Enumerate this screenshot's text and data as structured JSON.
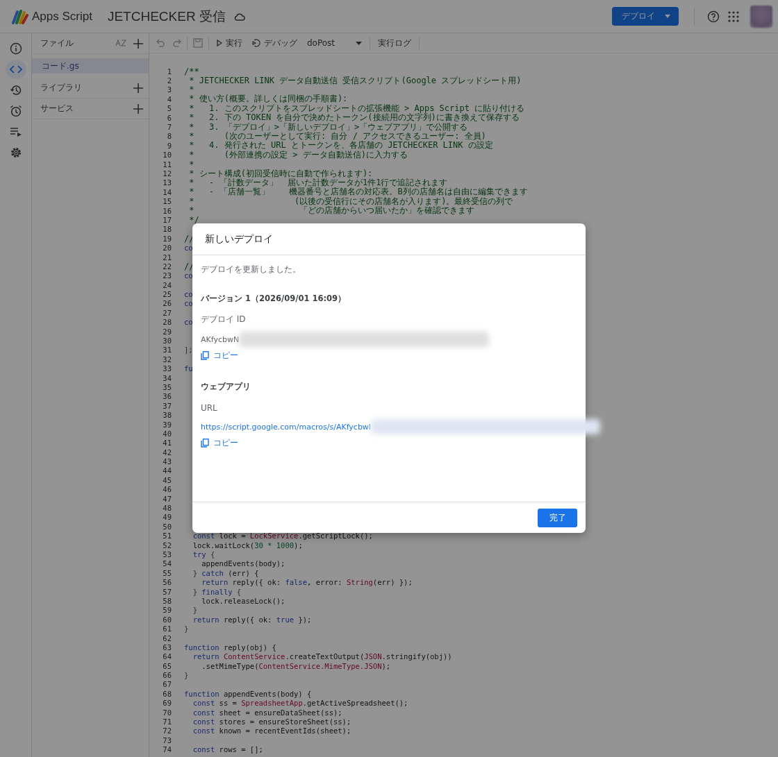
{
  "app": {
    "name": "Apps Script",
    "project_title": "JETCHECKER 受信",
    "deploy_button": "デプロイ"
  },
  "rail": [
    {
      "kind": "info",
      "selected": false
    },
    {
      "kind": "code",
      "selected": true
    },
    {
      "kind": "history",
      "selected": false
    },
    {
      "kind": "triggers",
      "selected": false
    },
    {
      "kind": "executions",
      "selected": false
    },
    {
      "kind": "settings",
      "selected": false
    }
  ],
  "files_panel": {
    "title": "ファイル",
    "files": [
      {
        "name": "コード.gs",
        "selected": true
      }
    ],
    "sections": [
      "ライブラリ",
      "サービス"
    ]
  },
  "toolbar": {
    "run": "実行",
    "debug": "デバッグ",
    "function": "doPost",
    "log": "実行ログ"
  },
  "editor": {
    "lines": [
      {
        "number": "1",
        "kind": "comment",
        "text": "/**"
      },
      {
        "number": "2",
        "kind": "comment",
        "text": " * JETCHECKER LINK データ自動送信 受信スクリプト(Google スプレッドシート用)"
      },
      {
        "number": "3",
        "kind": "comment",
        "text": " *"
      },
      {
        "number": "4",
        "kind": "comment",
        "text": " * 使い方(概要。詳しくは同梱の手順書):"
      },
      {
        "number": "5",
        "kind": "comment",
        "text": " *   1. このスクリプトをスプレッドシートの拡張機能 > Apps Script に貼り付ける"
      },
      {
        "number": "6",
        "kind": "comment",
        "text": " *   2. 下の TOKEN を自分で決めたトークン(接続用の文字列)に書き換えて保存する"
      },
      {
        "number": "7",
        "kind": "comment",
        "text": " *   3. 「デプロイ」>「新しいデプロイ」>「ウェブアプリ」で公開する"
      },
      {
        "number": "8",
        "kind": "comment",
        "text": " *      (次のユーザーとして実行: 自分 / アクセスできるユーザー: 全員)"
      },
      {
        "number": "9",
        "kind": "comment",
        "text": " *   4. 発行された URL とトークンを、各店舗の JETCHECKER LINK の設定"
      },
      {
        "number": "10",
        "kind": "comment",
        "text": " *      (外部連携の設定 > データ自動送信)に入力する"
      },
      {
        "number": "11",
        "kind": "comment",
        "text": " *"
      },
      {
        "number": "12",
        "kind": "comment",
        "text": " * シート構成(初回受信時に自動で作られます):"
      },
      {
        "number": "13",
        "kind": "comment",
        "text": " *   - 「計数データ」  届いた計数データが1件1行で追記されます"
      },
      {
        "number": "14",
        "kind": "comment",
        "text": " *   - 「店舗一覧」    機器番号と店舗名の対応表。B列の店舗名は自由に編集できます"
      },
      {
        "number": "15",
        "kind": "comment",
        "text": " *                    (以後の受信行にその店舗名が入ります)。最終受信の列で"
      },
      {
        "number": "16",
        "kind": "comment",
        "text": " *                     「どの店舗からいつ届いたか」を確認できます"
      },
      {
        "number": "17",
        "kind": "comment",
        "text": " */"
      },
      {
        "number": "18",
        "kind": "blank"
      },
      {
        "number": "19",
        "kind": "comment",
        "text": "//"
      },
      {
        "number": "20",
        "kind": "code",
        "tokens": [
          {
            "text": "co",
            "kind": "keyword"
          }
        ]
      },
      {
        "number": "21",
        "kind": "blank"
      },
      {
        "number": "22",
        "kind": "comment",
        "text": "//"
      },
      {
        "number": "23",
        "kind": "code",
        "tokens": [
          {
            "text": "co",
            "kind": "keyword"
          }
        ]
      },
      {
        "number": "24",
        "kind": "blank"
      },
      {
        "number": "25",
        "kind": "code",
        "tokens": [
          {
            "text": "co",
            "kind": "keyword"
          }
        ]
      },
      {
        "number": "26",
        "kind": "code",
        "tokens": [
          {
            "text": "co",
            "kind": "keyword"
          }
        ]
      },
      {
        "number": "27",
        "kind": "blank"
      },
      {
        "number": "28",
        "kind": "code",
        "tokens": [
          {
            "text": "co",
            "kind": "keyword"
          }
        ]
      },
      {
        "number": "29",
        "kind": "blank"
      },
      {
        "number": "30",
        "kind": "blank"
      },
      {
        "number": "31",
        "kind": "code",
        "tokens": [
          {
            "text": "];",
            "kind": "punct"
          }
        ]
      },
      {
        "number": "32",
        "kind": "blank"
      },
      {
        "number": "33",
        "kind": "code",
        "tokens": [
          {
            "text": "fu",
            "kind": "keyword"
          }
        ]
      },
      {
        "number": "34",
        "kind": "blank"
      },
      {
        "number": "35",
        "kind": "blank"
      },
      {
        "number": "36",
        "kind": "blank"
      },
      {
        "number": "37",
        "kind": "blank"
      },
      {
        "number": "38",
        "kind": "blank"
      },
      {
        "number": "39",
        "kind": "blank"
      },
      {
        "number": "40",
        "kind": "blank"
      },
      {
        "number": "41",
        "kind": "blank"
      },
      {
        "number": "42",
        "kind": "blank"
      },
      {
        "number": "43",
        "kind": "blank"
      },
      {
        "number": "44",
        "kind": "blank"
      },
      {
        "number": "45",
        "kind": "blank"
      },
      {
        "number": "46",
        "kind": "blank"
      },
      {
        "number": "47",
        "kind": "blank"
      },
      {
        "number": "48",
        "kind": "blank"
      },
      {
        "number": "49",
        "kind": "blank"
      },
      {
        "number": "50",
        "kind": "blank"
      },
      {
        "number": "51",
        "kind": "code",
        "tokens": [
          {
            "text": "  const",
            "kind": "keyword"
          },
          {
            "text": " lock = ",
            "kind": "plain"
          },
          {
            "text": "LockService",
            "kind": "class"
          },
          {
            "text": ".getScriptLock();",
            "kind": "plain"
          }
        ]
      },
      {
        "number": "52",
        "kind": "code",
        "tokens": [
          {
            "text": "  lock.waitLock(",
            "kind": "plain"
          },
          {
            "text": "30 * 1000",
            "kind": "number"
          },
          {
            "text": ");",
            "kind": "plain"
          }
        ]
      },
      {
        "number": "53",
        "kind": "code",
        "tokens": [
          {
            "text": "  try",
            "kind": "keyword"
          },
          {
            "text": " {",
            "kind": "punct"
          }
        ]
      },
      {
        "number": "54",
        "kind": "code",
        "tokens": [
          {
            "text": "    appendEvents(body);",
            "kind": "plain"
          }
        ]
      },
      {
        "number": "55",
        "kind": "code",
        "tokens": [
          {
            "text": "  }",
            "kind": "punct"
          },
          {
            "text": " catch",
            "kind": "keyword"
          },
          {
            "text": " (err) {",
            "kind": "plain"
          }
        ]
      },
      {
        "number": "56",
        "kind": "code",
        "tokens": [
          {
            "text": "    return",
            "kind": "keyword"
          },
          {
            "text": " reply({ ok: ",
            "kind": "plain"
          },
          {
            "text": "false",
            "kind": "keyword"
          },
          {
            "text": ", error: ",
            "kind": "plain"
          },
          {
            "text": "String",
            "kind": "class"
          },
          {
            "text": "(err) });",
            "kind": "plain"
          }
        ]
      },
      {
        "number": "57",
        "kind": "code",
        "tokens": [
          {
            "text": "  }",
            "kind": "punct"
          },
          {
            "text": " finally",
            "kind": "keyword"
          },
          {
            "text": " {",
            "kind": "punct"
          }
        ]
      },
      {
        "number": "58",
        "kind": "code",
        "tokens": [
          {
            "text": "    lock.releaseLock();",
            "kind": "plain"
          }
        ]
      },
      {
        "number": "59",
        "kind": "code",
        "tokens": [
          {
            "text": "  }",
            "kind": "punct"
          }
        ]
      },
      {
        "number": "60",
        "kind": "code",
        "tokens": [
          {
            "text": "  return",
            "kind": "keyword"
          },
          {
            "text": " reply({ ok: ",
            "kind": "plain"
          },
          {
            "text": "true",
            "kind": "keyword"
          },
          {
            "text": " });",
            "kind": "plain"
          }
        ]
      },
      {
        "number": "61",
        "kind": "code",
        "tokens": [
          {
            "text": "}",
            "kind": "punct"
          }
        ]
      },
      {
        "number": "62",
        "kind": "blank"
      },
      {
        "number": "63",
        "kind": "code",
        "tokens": [
          {
            "text": "function",
            "kind": "keyword"
          },
          {
            "text": " reply(obj) {",
            "kind": "plain"
          }
        ]
      },
      {
        "number": "64",
        "kind": "code",
        "tokens": [
          {
            "text": "  return ",
            "kind": "keyword"
          },
          {
            "text": "ContentService",
            "kind": "class"
          },
          {
            "text": ".createTextOutput(",
            "kind": "plain"
          },
          {
            "text": "JSON",
            "kind": "class"
          },
          {
            "text": ".stringify(obj))",
            "kind": "plain"
          }
        ]
      },
      {
        "number": "65",
        "kind": "code",
        "tokens": [
          {
            "text": "    .setMimeType(",
            "kind": "plain"
          },
          {
            "text": "ContentService.MimeType.JSON",
            "kind": "class"
          },
          {
            "text": ");",
            "kind": "plain"
          }
        ]
      },
      {
        "number": "66",
        "kind": "code",
        "tokens": [
          {
            "text": "}",
            "kind": "punct"
          }
        ]
      },
      {
        "number": "67",
        "kind": "blank"
      },
      {
        "number": "68",
        "kind": "code",
        "tokens": [
          {
            "text": "function",
            "kind": "keyword"
          },
          {
            "text": " appendEvents(body) {",
            "kind": "plain"
          }
        ]
      },
      {
        "number": "69",
        "kind": "code",
        "tokens": [
          {
            "text": "  const",
            "kind": "keyword"
          },
          {
            "text": " ss = ",
            "kind": "plain"
          },
          {
            "text": "SpreadsheetApp",
            "kind": "class"
          },
          {
            "text": ".getActiveSpreadsheet();",
            "kind": "plain"
          }
        ]
      },
      {
        "number": "70",
        "kind": "code",
        "tokens": [
          {
            "text": "  const",
            "kind": "keyword"
          },
          {
            "text": " sheet = ensureDataSheet(ss);",
            "kind": "plain"
          }
        ]
      },
      {
        "number": "71",
        "kind": "code",
        "tokens": [
          {
            "text": "  const",
            "kind": "keyword"
          },
          {
            "text": " stores = ensureStoreSheet(ss);",
            "kind": "plain"
          }
        ]
      },
      {
        "number": "72",
        "kind": "code",
        "tokens": [
          {
            "text": "  const",
            "kind": "keyword"
          },
          {
            "text": " known = recentEventIds(sheet);",
            "kind": "plain"
          }
        ]
      },
      {
        "number": "73",
        "kind": "blank"
      },
      {
        "number": "74",
        "kind": "code",
        "tokens": [
          {
            "text": "  const",
            "kind": "keyword"
          },
          {
            "text": " rows = [];",
            "kind": "plain"
          }
        ]
      }
    ]
  },
  "dialog": {
    "title": "新しいデプロイ",
    "message": "デプロイを更新しました。",
    "version": "バージョン 1（2026/09/01 16:09）",
    "deployment_id": {
      "label": "デプロイ ID",
      "value": "AKfycbwN",
      "copy": "コピー"
    },
    "web_app": {
      "heading": "ウェブアプリ",
      "label": "URL",
      "url": "https://script.google.com/macros/s/AKfycbwl",
      "copy": "コピー"
    },
    "done_button": "完了"
  }
}
